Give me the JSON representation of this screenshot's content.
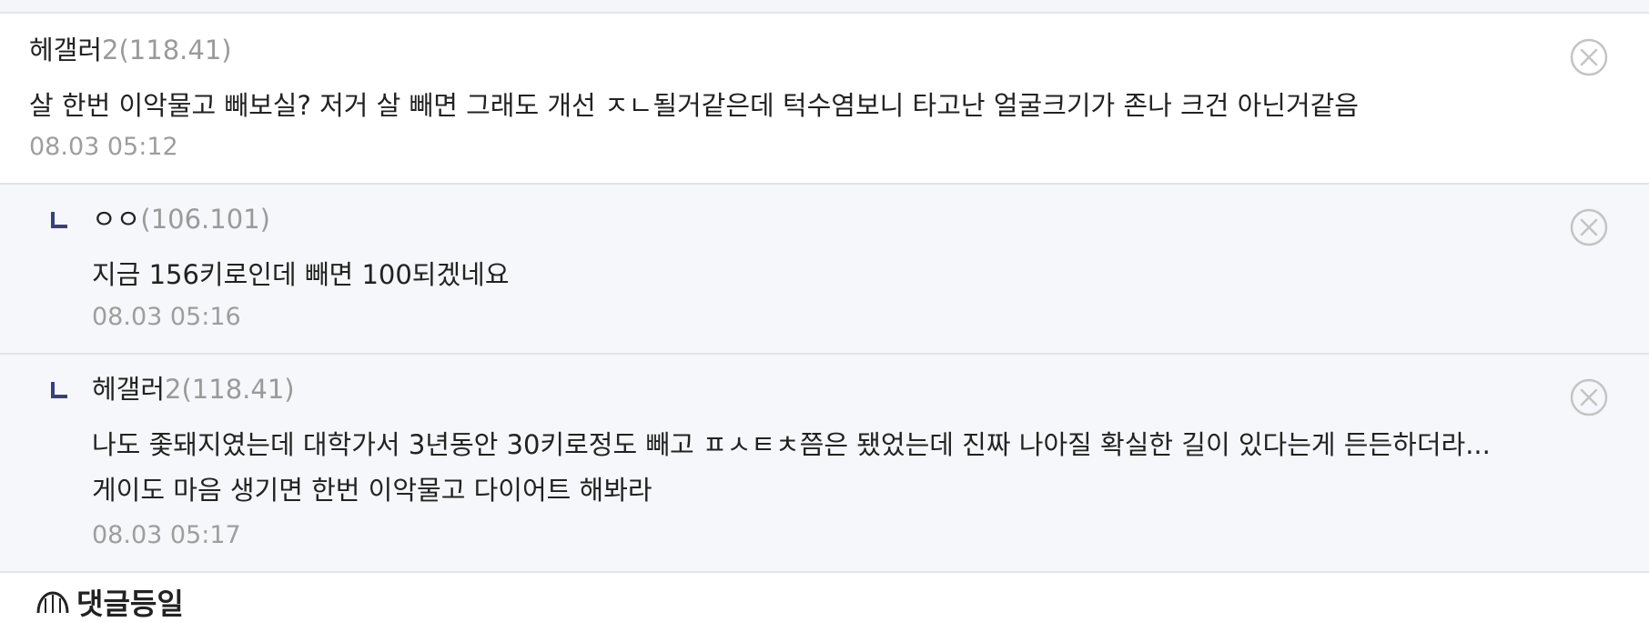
{
  "comments": [
    {
      "nickname": "헤갤러",
      "ip": "2(118.41)",
      "text": "살 한번 이악물고 빼보실? 저거 살 빼면 그래도 개선 ㅈㄴ될거같은데 턱수염보니 타고난 얼굴크기가 존나 크건 아닌거같음",
      "date": "08.03 05:12"
    },
    {
      "nickname": "ㅇㅇ",
      "ip": "(106.101)",
      "text": "지금 156키로인데 빼면 100되겠네요",
      "date": "08.03 05:16"
    },
    {
      "nickname": "헤갤러",
      "ip": "2(118.41)",
      "text_line1": "나도 좇돼지였는데 대학가서 3년동안 30키로정도 빼고 ㅍㅅㅌㅊ쯤은 됐었는데 진짜 나아질 확실한 길이 있다는게 든든하더라...",
      "text_line2": "게이도 마음 생기면 한번 이악물고 다이어트 해봐라",
      "date": "08.03 05:17"
    }
  ],
  "section": {
    "title": "댓글등일"
  },
  "icons": {
    "close": "close-circle-icon",
    "reply": "reply-arrow-icon",
    "section": "section-icon"
  },
  "colors": {
    "ip": "#9a9a9a",
    "date": "#9e9e9e",
    "reply_mark": "#3b3f7a",
    "reply_bg": "#f6f7fa",
    "close": "#c4c4c4"
  }
}
